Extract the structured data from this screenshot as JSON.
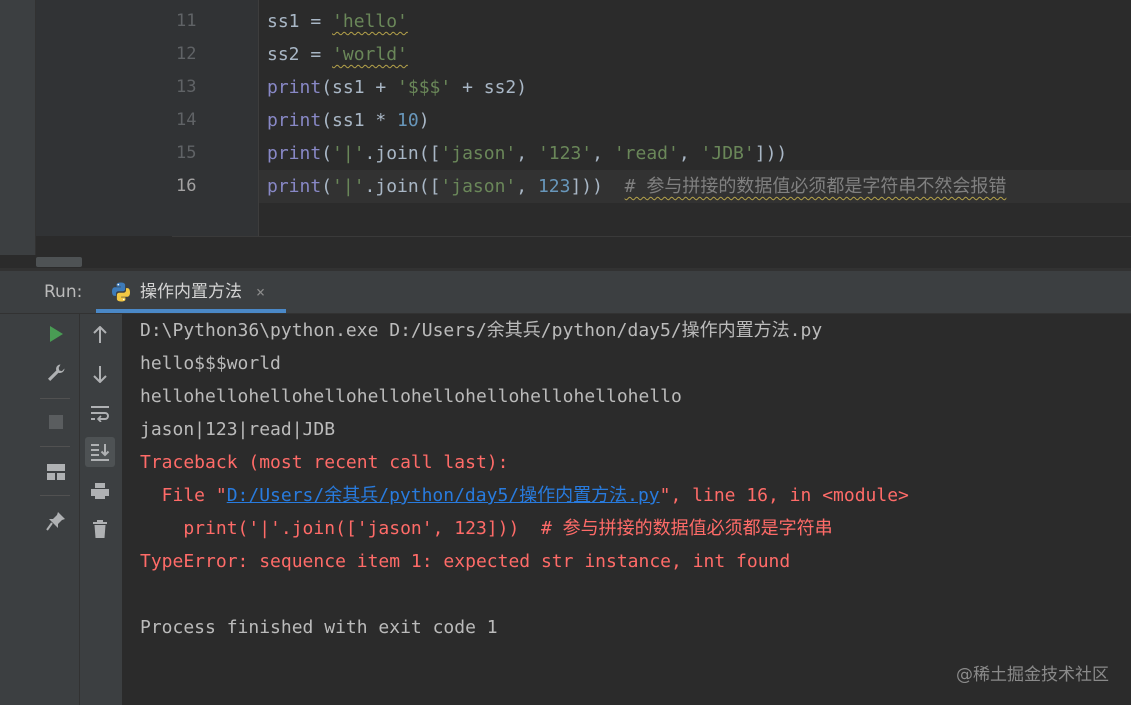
{
  "editor": {
    "lines": [
      {
        "num": "11",
        "parts": [
          [
            "plain",
            "ss1 = "
          ],
          [
            "str",
            "'hello'"
          ]
        ]
      },
      {
        "num": "12",
        "parts": [
          [
            "plain",
            "ss2 = "
          ],
          [
            "str",
            "'world'"
          ]
        ]
      },
      {
        "num": "13",
        "parts": [
          [
            "kw",
            "print"
          ],
          [
            "plain",
            "(ss1 + "
          ],
          [
            "str",
            "'$$$'"
          ],
          [
            "plain",
            " + ss2)"
          ]
        ]
      },
      {
        "num": "14",
        "parts": [
          [
            "kw",
            "print"
          ],
          [
            "plain",
            "(ss1 * "
          ],
          [
            "num",
            "10"
          ],
          [
            "plain",
            ")"
          ]
        ]
      },
      {
        "num": "15",
        "parts": [
          [
            "kw",
            "print"
          ],
          [
            "plain",
            "("
          ],
          [
            "str",
            "'|'"
          ],
          [
            "plain",
            ".join(["
          ],
          [
            "str",
            "'jason'"
          ],
          [
            "plain",
            ", "
          ],
          [
            "str",
            "'123'"
          ],
          [
            "plain",
            ", "
          ],
          [
            "str",
            "'read'"
          ],
          [
            "plain",
            ", "
          ],
          [
            "str",
            "'JDB'"
          ],
          [
            "plain",
            "]))"
          ]
        ]
      },
      {
        "num": "16",
        "parts": [
          [
            "kw",
            "print"
          ],
          [
            "plain",
            "("
          ],
          [
            "str",
            "'|'"
          ],
          [
            "plain",
            ".join(["
          ],
          [
            "str",
            "'jason'"
          ],
          [
            "plain",
            ", "
          ],
          [
            "num",
            "123"
          ],
          [
            "plain",
            "]))  "
          ],
          [
            "cmt",
            "# 参与拼接的数据值必须都是字符串不然会报错"
          ]
        ]
      }
    ],
    "current_line": "16"
  },
  "run_panel": {
    "label": "Run:",
    "tab_label": "操作内置方法",
    "tab_close": "×",
    "tab_icon": "python-icon"
  },
  "toolbar": {
    "left": [
      "run-icon",
      "wrench-icon",
      "stop-icon",
      "layout-icon",
      "pin-icon"
    ],
    "right": [
      "arrow-up-icon",
      "arrow-down-icon",
      "soft-wrap-icon",
      "scroll-to-end-icon",
      "print-icon",
      "trash-icon"
    ]
  },
  "console": {
    "lines": [
      {
        "type": "normal",
        "text": "D:\\Python36\\python.exe D:/Users/余其兵/python/day5/操作内置方法.py"
      },
      {
        "type": "normal",
        "text": "hello$$$world"
      },
      {
        "type": "normal",
        "text": "hellohellohellohellohellohellohellohellohellohello"
      },
      {
        "type": "normal",
        "text": "jason|123|read|JDB"
      },
      {
        "type": "error",
        "text": "Traceback (most recent call last):"
      },
      {
        "type": "error-file",
        "prefix": "  File \"",
        "link": "D:/Users/余其兵/python/day5/操作内置方法.py",
        "suffix": "\", line 16, in <module>"
      },
      {
        "type": "error",
        "text": "    print('|'.join(['jason', 123]))  # 参与拼接的数据值必须都是字符串"
      },
      {
        "type": "error",
        "text": "TypeError: sequence item 1: expected str instance, int found"
      },
      {
        "type": "blank",
        "text": ""
      },
      {
        "type": "normal",
        "text": "Process finished with exit code 1"
      }
    ]
  },
  "watermark": "@稀土掘金技术社区",
  "colors": {
    "keyword": "#8888c6",
    "string": "#6a8759",
    "number": "#6897bb",
    "comment": "#808080",
    "error": "#ff6b68",
    "link": "#287bde",
    "run_green": "#499c54"
  }
}
